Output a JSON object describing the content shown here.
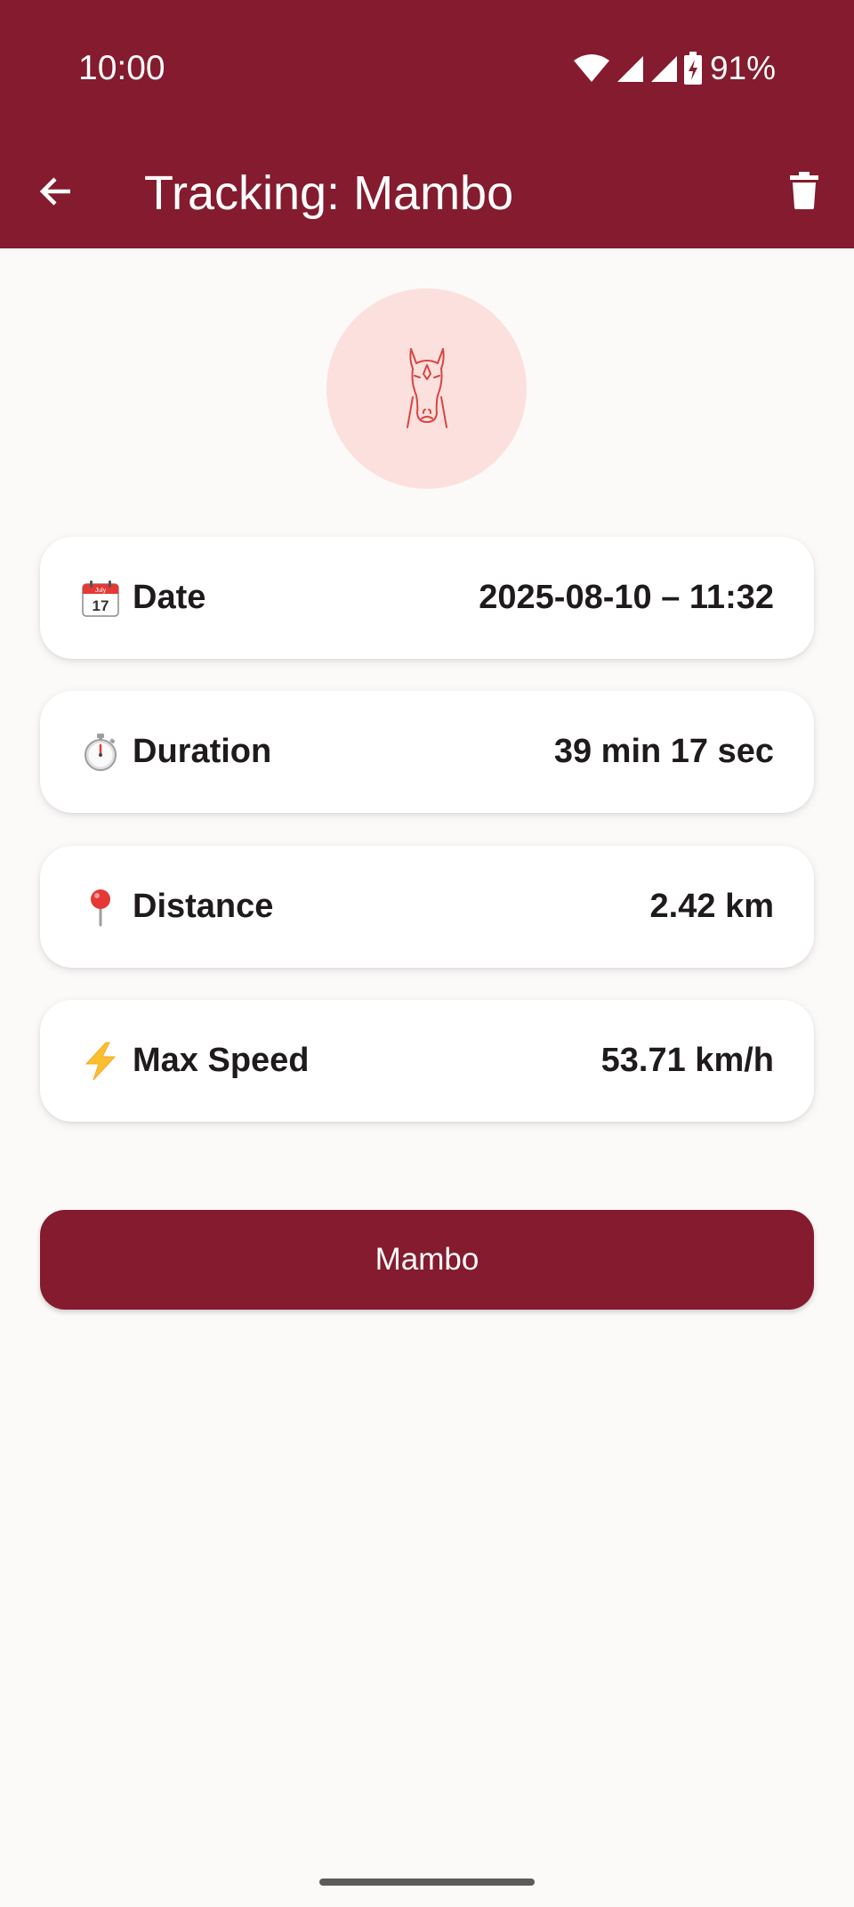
{
  "status_bar": {
    "time": "10:00",
    "battery": "91%",
    "icons": [
      "wifi-icon",
      "signal-icon",
      "signal-icon",
      "battery-charging-icon"
    ]
  },
  "app_bar": {
    "title": "Tracking: Mambo",
    "back_icon": "arrow-back-icon",
    "delete_icon": "trash-icon"
  },
  "avatar": {
    "icon": "horse-head-icon"
  },
  "stats": [
    {
      "icon": "calendar-icon",
      "label": "Date",
      "value": "2025-08-10 – 11:32"
    },
    {
      "icon": "stopwatch-icon",
      "label": "Duration",
      "value": "39 min 17 sec"
    },
    {
      "icon": "pin-icon",
      "label": "Distance",
      "value": "2.42 km"
    },
    {
      "icon": "lightning-icon",
      "label": "Max Speed",
      "value": "53.71 km/h"
    }
  ],
  "calendar_glyph": {
    "month": "July",
    "day": "17"
  },
  "horse_button": {
    "label": "Mambo"
  },
  "colors": {
    "primary": "#841b2e",
    "background": "#fcfaf9",
    "avatar_bg": "#fbe0de",
    "horse_line": "#d9443f",
    "card": "#ffffff",
    "text": "#1f1b1c"
  }
}
